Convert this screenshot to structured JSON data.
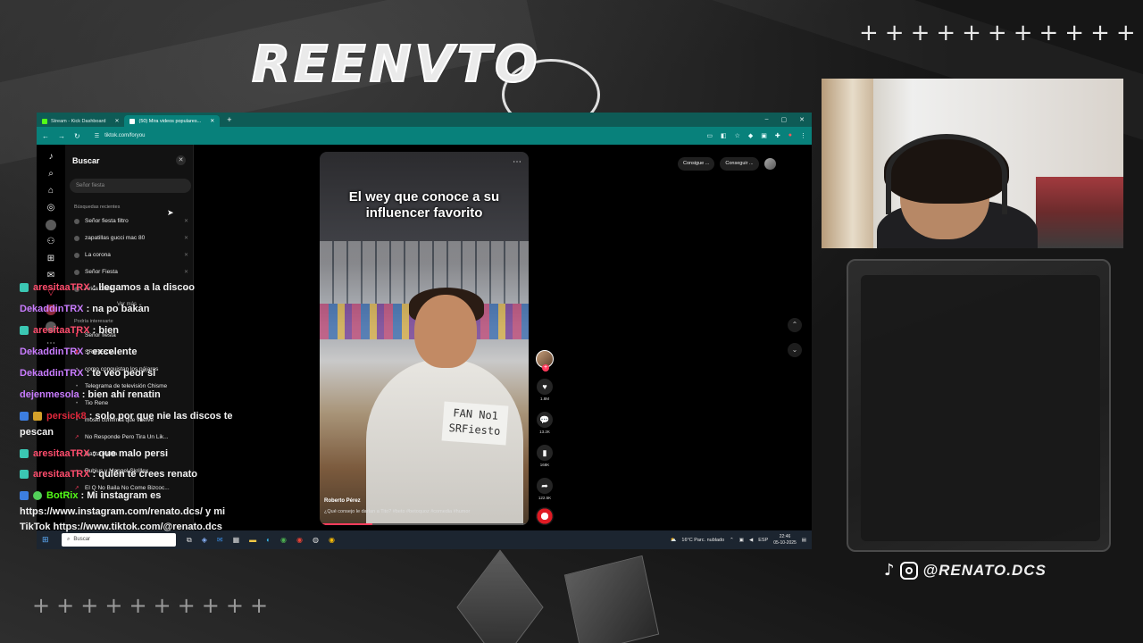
{
  "overlay": {
    "logo_text": "REENVTO",
    "crosses_top": "+++++++++++",
    "crosses_bottom": "++++++++++",
    "social_handle": "@RENATO.DCS"
  },
  "browser": {
    "tabs": [
      {
        "label": "Stream - Kick Dashboard",
        "icon": "kick-icon",
        "color": "#53fc18",
        "active": false
      },
      {
        "label": "(50) Mira videos populares...",
        "icon": "tiktok-icon",
        "color": "#ffffff",
        "active": true
      }
    ],
    "new_tab": "+",
    "url": "tiktok.com/foryou",
    "window_controls": [
      "–",
      "▢",
      "✕"
    ]
  },
  "sidebar": {
    "title": "Buscar",
    "close": "✕",
    "search_placeholder": "Señor fiesta",
    "recent_header": "Búsquedas recientes",
    "recent": [
      "Señor fiesta filtro",
      "zapatillas gucci mac 80",
      "La corona",
      "Señor Fiesta",
      "Arica Chile"
    ],
    "remove_glyph": "✕",
    "see_more": "Ver más ⌄",
    "suggest_header": "Podría interesarte",
    "suggestions": [
      {
        "label": "Señor fiesta",
        "marker": "⬆",
        "hot": true
      },
      {
        "label": "SR FIESTA",
        "marker": "⬆",
        "hot": true
      },
      {
        "label": "como conquistan los pájaros",
        "marker": "•",
        "hot": false
      },
      {
        "label": "Telegrama de televisión Chisme",
        "marker": "•",
        "hot": false
      },
      {
        "label": "Tio Rene",
        "marker": "•",
        "hot": false
      },
      {
        "label": "moski confirma que vuelve",
        "marker": "•",
        "hot": false
      },
      {
        "label": "No Responde Pero Tira Un Lik...",
        "marker": "↗",
        "hot": true
      },
      {
        "label": "Gatita malita",
        "marker": "•",
        "hot": false
      },
      {
        "label": "Rubius y Mangel Skrillex",
        "marker": "•",
        "hot": false
      },
      {
        "label": "El Q No Baila No Come Bizcoc...",
        "marker": "↗",
        "hot": true
      }
    ]
  },
  "rail_icons": [
    "tiktok-logo-icon",
    "search-icon",
    "home-icon",
    "compass-icon",
    "live-icon",
    "following-icon",
    "upload-icon",
    "inbox-icon",
    "activity-icon",
    "profile-icon",
    "avatar-icon",
    "more-icon"
  ],
  "video": {
    "caption": "El wey que conoce a su influencer favorito",
    "sign_text": "FAN No1\nSRFiesto",
    "author": "Roberto Pérez",
    "description": "¿Qué consejo le darían a Tito? #beto #betoquoz #comedia #humor",
    "progress": 0.25,
    "more": "⋯"
  },
  "actions": {
    "likes": "1.8M",
    "comments": "13.2K",
    "saves": "168K",
    "shares": "122.5K"
  },
  "topbar": {
    "btn1": "Consigue ...",
    "btn2": "Conseguir ..."
  },
  "taskbar": {
    "search_placeholder": "Buscar",
    "weather": "16°C  Parc. nublado",
    "lang": "ESP",
    "time": "22:46",
    "date": "05-10-2025"
  },
  "chat": [
    {
      "user": "aresitaaTRX",
      "color": "#ff4d6d",
      "text": "llegamos a la discoo",
      "badges": [
        "b-teal"
      ]
    },
    {
      "user": "DekaddinTRX",
      "color": "#c97cff",
      "text": "na po bakan",
      "badges": []
    },
    {
      "user": "aresitaaTRX",
      "color": "#ff4d6d",
      "text": "bien",
      "badges": [
        "b-teal"
      ]
    },
    {
      "user": "DekaddinTRX",
      "color": "#c97cff",
      "text": "excelente",
      "badges": []
    },
    {
      "user": "DekaddinTRX",
      "color": "#c97cff",
      "text": "te veo peor si",
      "badges": []
    },
    {
      "user": "dejenmesola",
      "color": "#c97cff",
      "text": "bien ahí renatin",
      "badges": []
    },
    {
      "user": "persick8",
      "color": "#e0283c",
      "text": "solo por que nie las discos te pescan",
      "badges": [
        "b-blue",
        "b-gold"
      ]
    },
    {
      "user": "aresitaaTRX",
      "color": "#ff4d6d",
      "text": "que malo persi",
      "badges": [
        "b-teal"
      ]
    },
    {
      "user": "aresitaaTRX",
      "color": "#ff4d6d",
      "text": "quién te crees renato",
      "badges": [
        "b-teal"
      ]
    },
    {
      "user": "BotRix",
      "color": "#53fc18",
      "text": "Mi instagram es https://www.instagram.com/renato.dcs/ y mi TikTok https://www.tiktok.com/@renato.dcs",
      "badges": [
        "b-blue",
        "b-green"
      ]
    }
  ]
}
